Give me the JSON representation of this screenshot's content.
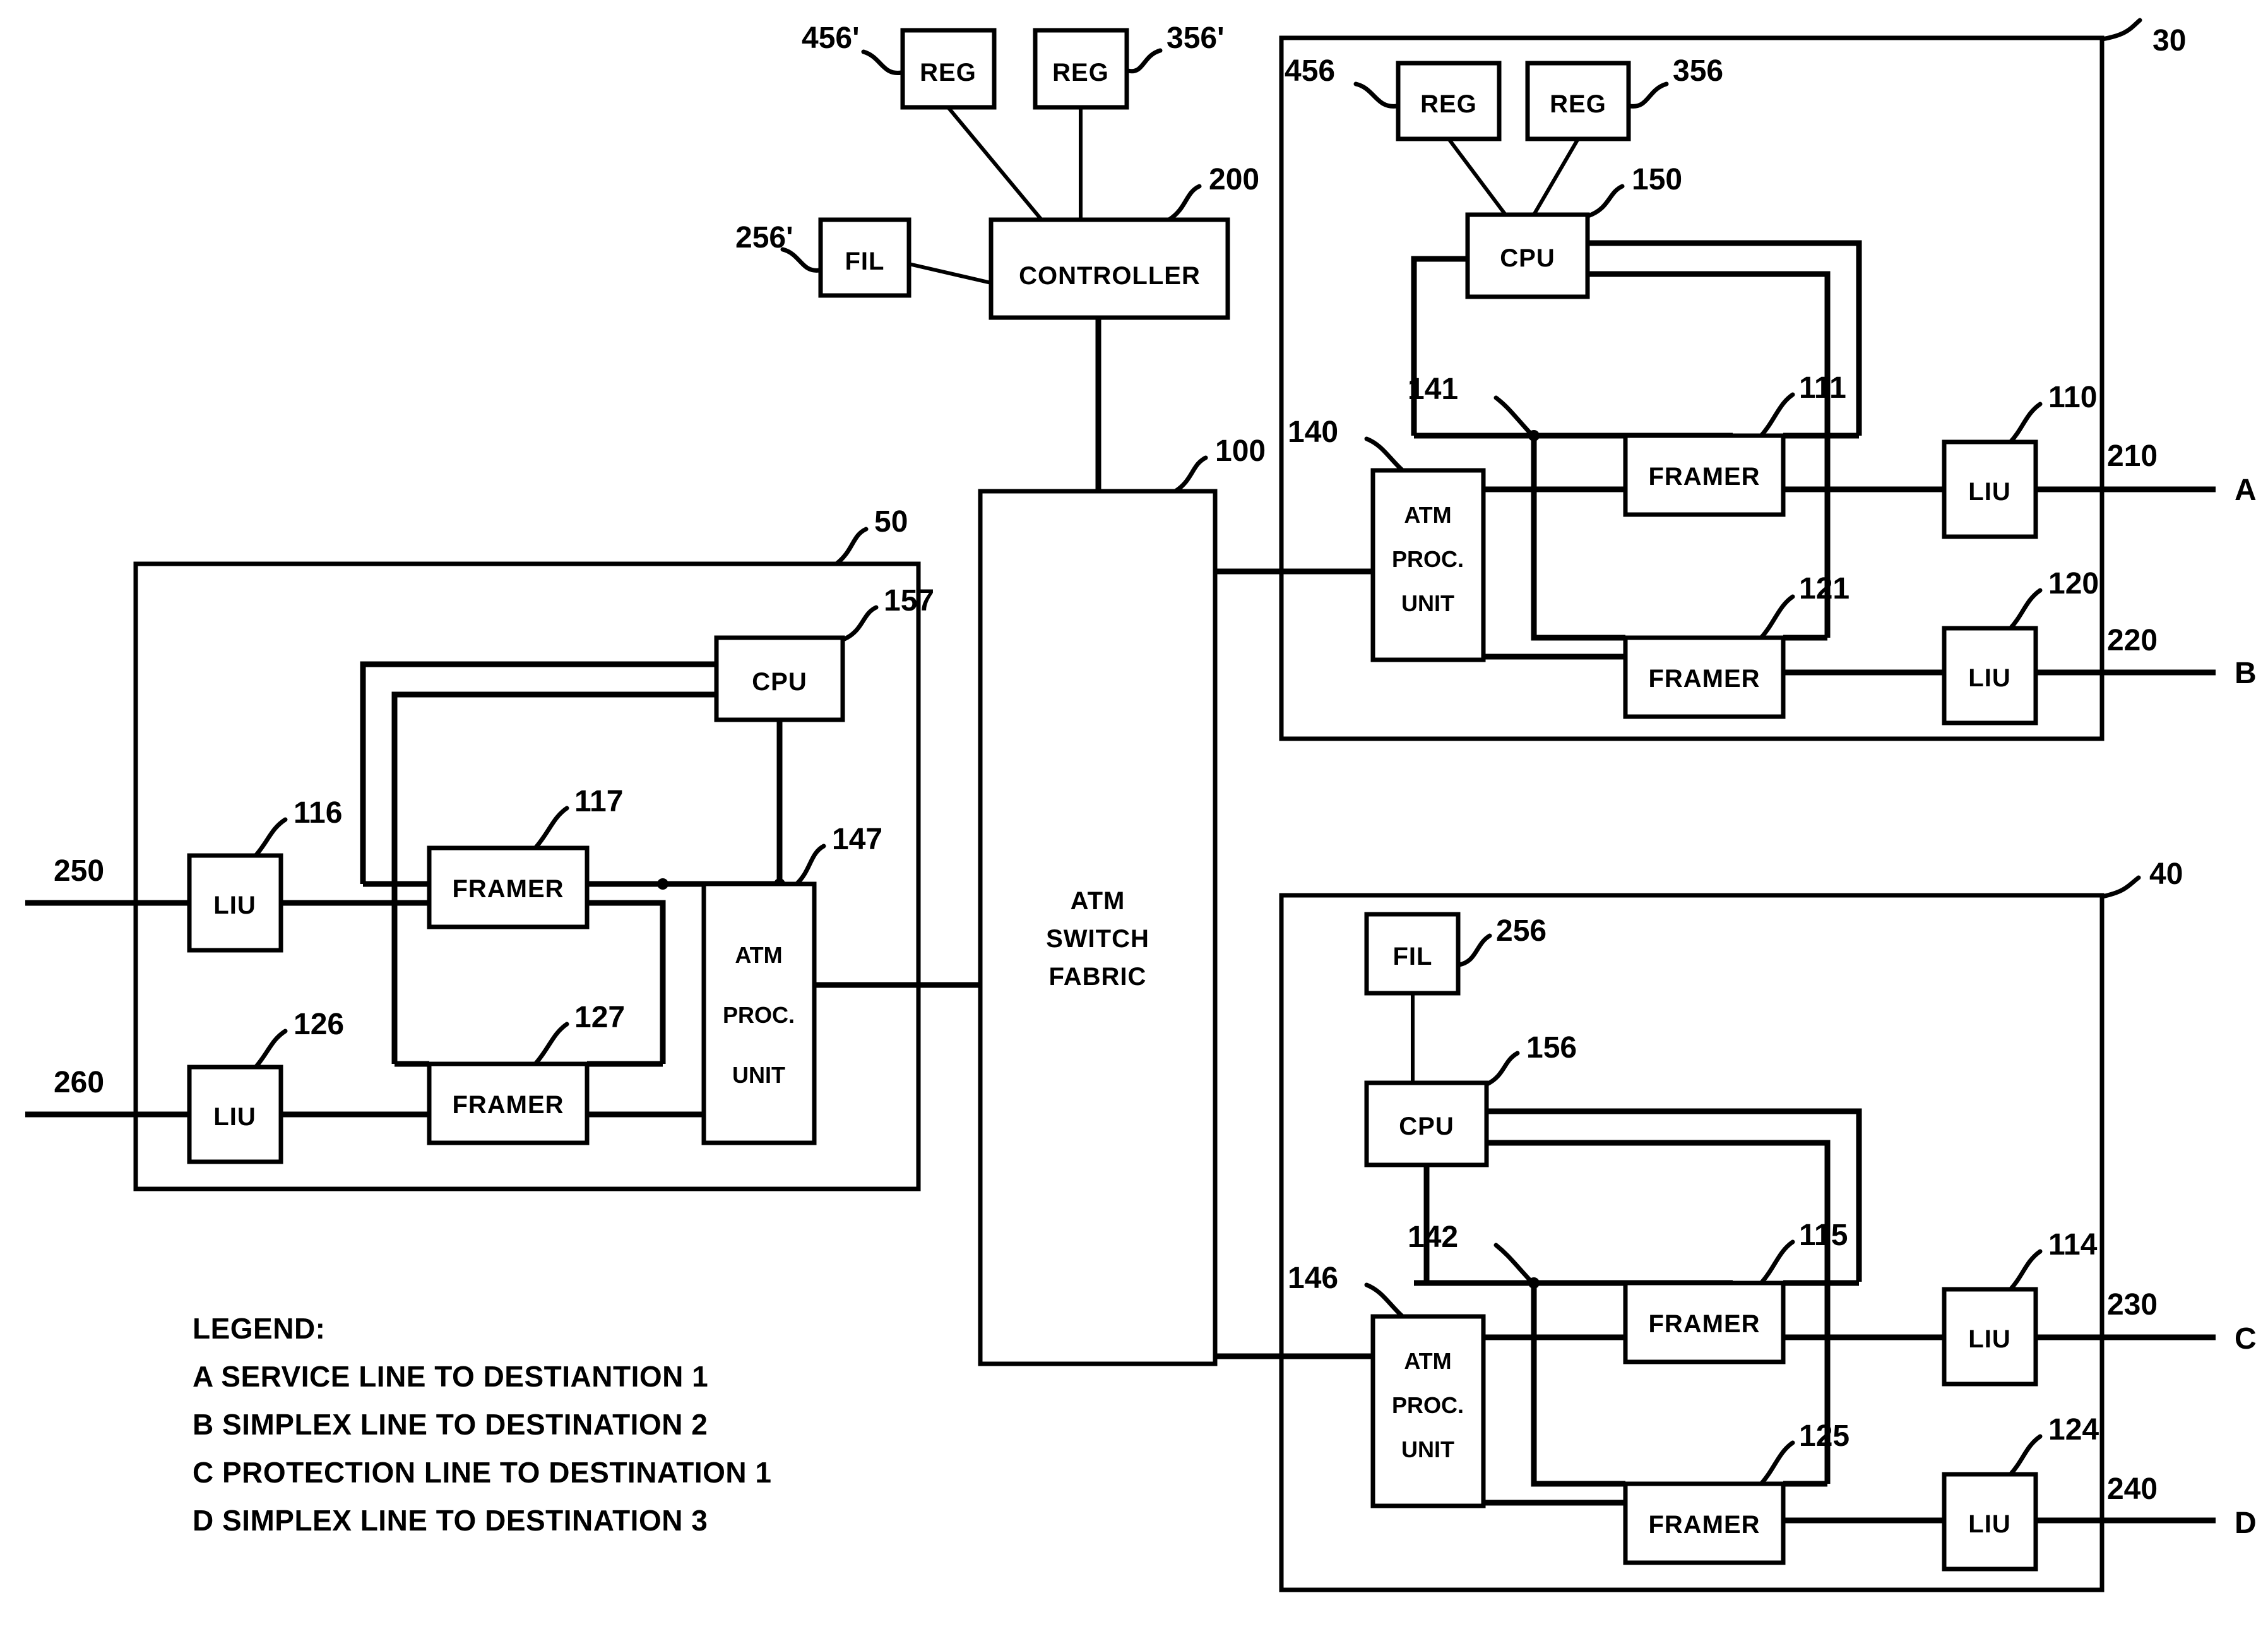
{
  "diagram": {
    "title": "ATM switch redundancy block diagram",
    "panels": [
      {
        "id": "panel-30",
        "ref": "30"
      },
      {
        "id": "panel-40",
        "ref": "40"
      },
      {
        "id": "panel-50",
        "ref": "50"
      }
    ]
  },
  "controller_group": {
    "reg_left": {
      "label": "REG",
      "ref": "456'"
    },
    "reg_right": {
      "label": "REG",
      "ref": "356'"
    },
    "fil": {
      "label": "FIL",
      "ref": "256'"
    },
    "controller": {
      "label": "CONTROLLER",
      "ref": "200"
    }
  },
  "fabric": {
    "label_line1": "ATM",
    "label_line2": "SWITCH",
    "label_line3": "FABRIC",
    "ref": "100"
  },
  "panel30": {
    "ref": "30",
    "reg_left": {
      "label": "REG",
      "ref": "456"
    },
    "reg_right": {
      "label": "REG",
      "ref": "356"
    },
    "cpu": {
      "label": "CPU",
      "ref": "150"
    },
    "atm_unit": {
      "line1": "ATM",
      "line2": "PROC.",
      "line3": "UNIT",
      "ref": "140"
    },
    "bus_ref": "141",
    "framer_top": {
      "label": "FRAMER",
      "ref": "111"
    },
    "framer_bottom": {
      "label": "FRAMER",
      "ref": "121"
    },
    "liu_top": {
      "label": "LIU",
      "ref": "110"
    },
    "liu_bottom": {
      "label": "LIU",
      "ref": "120"
    },
    "out_top": {
      "ref": "210",
      "port": "A"
    },
    "out_bottom": {
      "ref": "220",
      "port": "B"
    }
  },
  "panel40": {
    "ref": "40",
    "fil": {
      "label": "FIL",
      "ref": "256"
    },
    "cpu": {
      "label": "CPU",
      "ref": "156"
    },
    "atm_unit": {
      "line1": "ATM",
      "line2": "PROC.",
      "line3": "UNIT",
      "ref": "146"
    },
    "bus_ref": "142",
    "framer_top": {
      "label": "FRAMER",
      "ref": "115"
    },
    "framer_bottom": {
      "label": "FRAMER",
      "ref": "125"
    },
    "liu_top": {
      "label": "LIU",
      "ref": "114"
    },
    "liu_bottom": {
      "label": "LIU",
      "ref": "124"
    },
    "out_top": {
      "ref": "230",
      "port": "C"
    },
    "out_bottom": {
      "ref": "240",
      "port": "D"
    }
  },
  "panel50": {
    "ref": "50",
    "cpu": {
      "label": "CPU",
      "ref": "157"
    },
    "atm_unit": {
      "line1": "ATM",
      "line2": "PROC.",
      "line3": "UNIT",
      "ref": "147"
    },
    "framer_top": {
      "label": "FRAMER",
      "ref": "117"
    },
    "framer_bottom": {
      "label": "FRAMER",
      "ref": "127"
    },
    "liu_top": {
      "label": "LIU",
      "ref": "116"
    },
    "liu_bottom": {
      "label": "LIU",
      "ref": "126"
    },
    "in_top": {
      "ref": "250"
    },
    "in_bottom": {
      "ref": "260"
    }
  },
  "legend": {
    "header": "LEGEND:",
    "lines": [
      "A SERVICE LINE TO DESTIANTION 1",
      "B SIMPLEX LINE TO DESTINATION 2",
      "C PROTECTION LINE TO DESTINATION 1",
      "D SIMPLEX LINE TO DESTINATION 3"
    ]
  }
}
